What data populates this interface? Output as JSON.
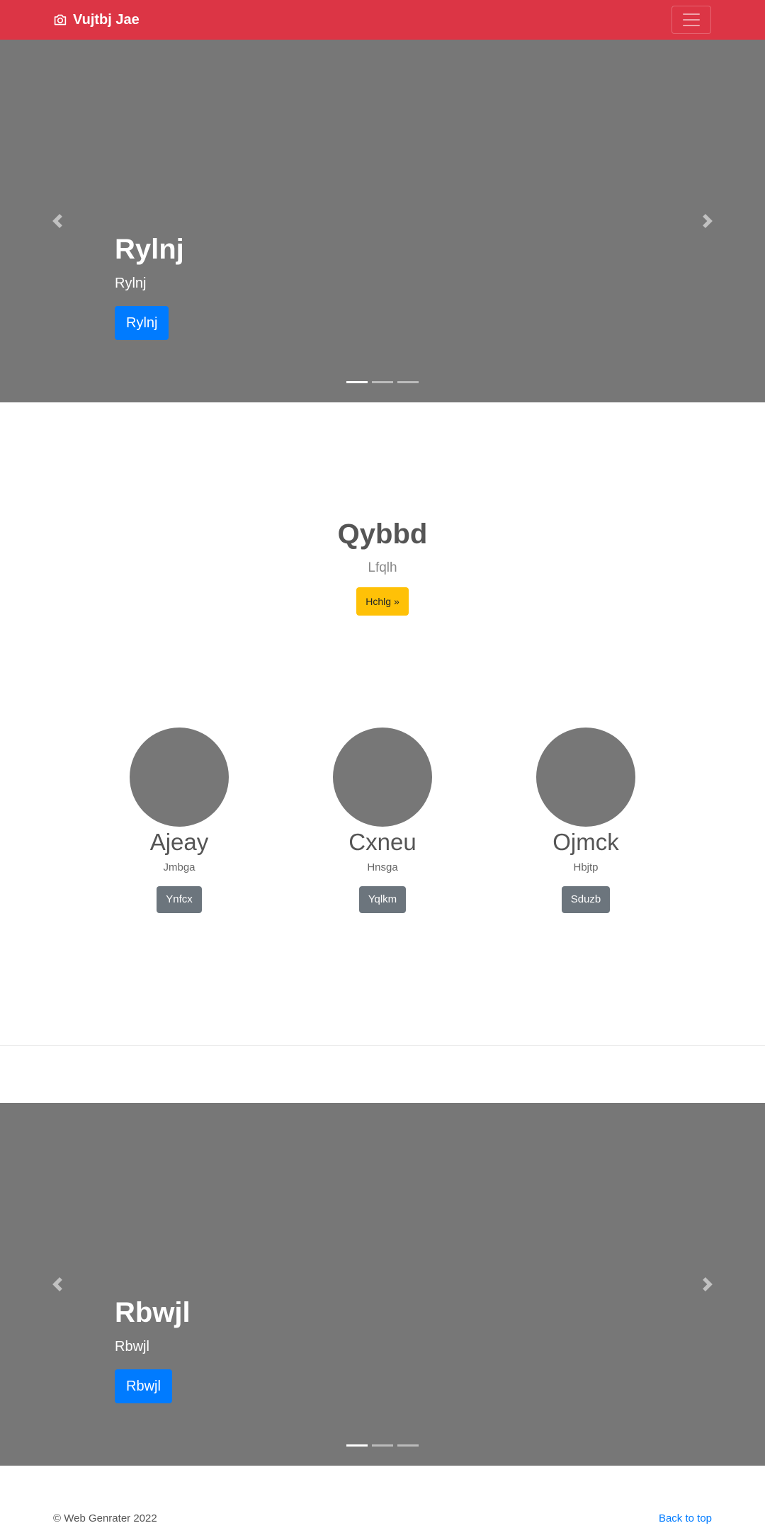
{
  "navbar": {
    "brand": "Vujtbj Jae",
    "brand_icon": "camera-icon",
    "toggler_icon": "hamburger-menu-icon",
    "color": "#dc3545"
  },
  "carousel_top": {
    "heading": "Rylnj",
    "text": "Rylnj",
    "button": "Rylnj",
    "prev_icon": "chevron-left-icon",
    "next_icon": "chevron-right-icon",
    "slides_count": 3,
    "active_slide": 1,
    "background": "#777777"
  },
  "jumbo": {
    "heading": "Qybbd",
    "lead": "Lfqlh",
    "button": "Hchlg »"
  },
  "columns": [
    {
      "heading": "Ajeay",
      "text": "Jmbga",
      "button": "Ynfcx"
    },
    {
      "heading": "Cxneu",
      "text": "Hnsga",
      "button": "Yqlkm"
    },
    {
      "heading": "Ojmck",
      "text": "Hbjtp",
      "button": "Sduzb"
    }
  ],
  "carousel_bottom": {
    "heading": "Rbwjl",
    "text": "Rbwjl",
    "button": "Rbwjl",
    "prev_icon": "chevron-left-icon",
    "next_icon": "chevron-right-icon",
    "slides_count": 3,
    "active_slide": 1,
    "background": "#777777"
  },
  "footer": {
    "copyright": "© Web Genrater 2022",
    "back_to_top": "Back to top"
  },
  "colors": {
    "primary": "#007bff",
    "warning": "#ffc107",
    "secondary": "#6c757d"
  }
}
